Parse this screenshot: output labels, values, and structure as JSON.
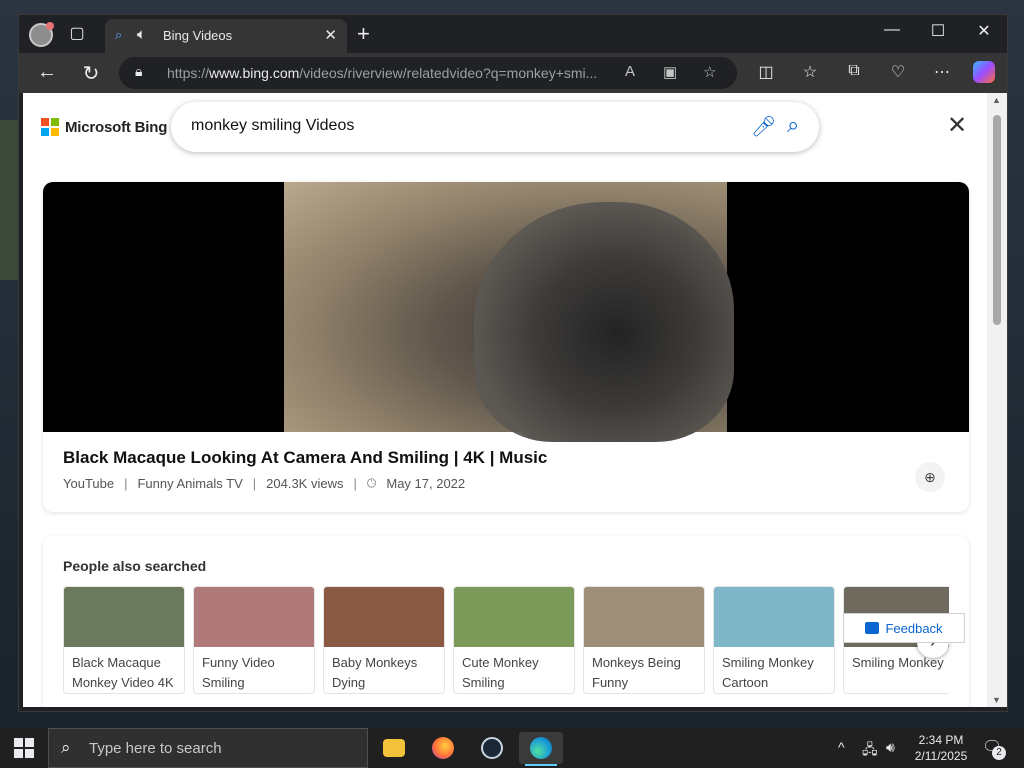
{
  "browser": {
    "tab": {
      "title": "Bing Videos",
      "close": "✕"
    },
    "new_tab": "+",
    "window_controls": {
      "minimize": "—",
      "maximize": "☐",
      "close": "✕"
    },
    "url": {
      "prefix": "https://",
      "domain": "www.bing.com",
      "path": "/videos/riverview/relatedvideo?q=monkey+smi..."
    },
    "icons": [
      "back-icon",
      "refresh-icon",
      "lock-icon",
      "read-aloud-icon",
      "immersive-reader-icon",
      "favorite-star-icon",
      "split-screen-icon",
      "favorites-icon",
      "collections-icon",
      "browser-essentials-icon",
      "more-icon",
      "copilot-icon"
    ]
  },
  "bing": {
    "logo_text": "Microsoft Bing",
    "search_query": "monkey smiling Videos",
    "brand_colors": [
      "#f25022",
      "#7fba00",
      "#00a4ef",
      "#ffb900"
    ]
  },
  "video": {
    "title": "Black Macaque Looking At Camera And Smiling | 4K | Music",
    "source": "YouTube",
    "channel": "Funny Animals TV",
    "views": "204.3K views",
    "date": "May 17, 2022",
    "separator": "|"
  },
  "people_also_searched": {
    "title": "People also searched",
    "items": [
      {
        "label": "Black Macaque Monkey Video 4K",
        "color": "#6b7a5c"
      },
      {
        "label": "Funny Video Smiling",
        "color": "#b07a7a"
      },
      {
        "label": "Baby Monkeys Dying",
        "color": "#8a5a45"
      },
      {
        "label": "Cute Monkey Smiling",
        "color": "#7c9b5a"
      },
      {
        "label": "Monkeys Being Funny",
        "color": "#9c8e78"
      },
      {
        "label": "Smiling Monkey Cartoon",
        "color": "#7fb7c9"
      },
      {
        "label": "Smiling Monkey",
        "color": "#6e6a5e"
      }
    ],
    "next": "›"
  },
  "feedback": {
    "label": "Feedback"
  },
  "taskbar": {
    "search_placeholder": "Type here to search",
    "time": "2:34 PM",
    "date": "2/11/2025",
    "notification_count": "2",
    "apps": [
      "file-explorer",
      "firefox",
      "steam",
      "edge"
    ]
  }
}
